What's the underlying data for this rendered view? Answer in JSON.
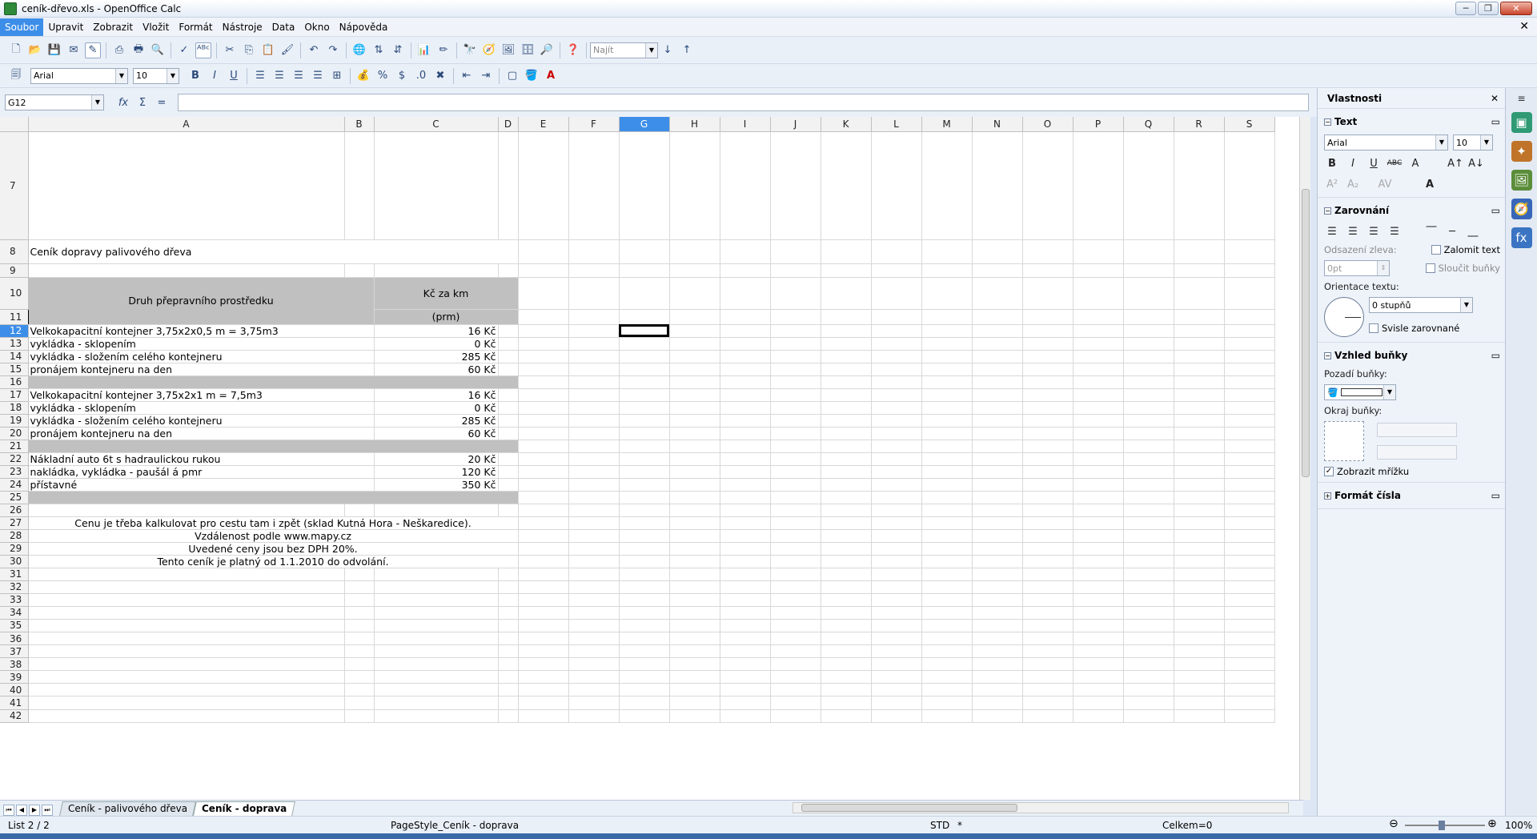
{
  "window": {
    "title": "ceník-dřevo.xls - OpenOffice Calc",
    "doc_close": "✕"
  },
  "menu": [
    "Soubor",
    "Upravit",
    "Zobrazit",
    "Vložit",
    "Formát",
    "Nástroje",
    "Data",
    "Okno",
    "Nápověda"
  ],
  "toolbar": {
    "find_placeholder": "Najít",
    "font_name": "Arial",
    "font_size": "10"
  },
  "formula_bar": {
    "cell_ref": "G12",
    "content": ""
  },
  "columns": [
    "A",
    "B",
    "C",
    "D",
    "E",
    "F",
    "G",
    "H",
    "I",
    "J",
    "K",
    "L",
    "M",
    "N",
    "O",
    "P",
    "Q",
    "R",
    "S"
  ],
  "selected_column": "G",
  "selected_row": "12",
  "sheet": {
    "title": "Ceník dopravy palivového dřeva",
    "header_vehicle": "Druh přepravního prostředku",
    "header_price_1": "Kč za km",
    "header_price_2": "(prm)",
    "rows": [
      {
        "row": "12",
        "label": "Velkokapacitní kontejner 3,75x2x0,5 m = 3,75m3",
        "price": "16 Kč",
        "bold": true
      },
      {
        "row": "13",
        "label": "vykládka - sklopením",
        "price": "0 Kč"
      },
      {
        "row": "14",
        "label": "vykládka - složením celého kontejneru",
        "price": "285 Kč"
      },
      {
        "row": "15",
        "label": "pronájem kontejneru na den",
        "price": "60 Kč"
      },
      {
        "row": "17",
        "label": "Velkokapacitní kontejner 3,75x2x1 m = 7,5m3",
        "price": "16 Kč",
        "bold": true
      },
      {
        "row": "18",
        "label": "vykládka - sklopením",
        "price": "0 Kč"
      },
      {
        "row": "19",
        "label": "vykládka - složením celého kontejneru",
        "price": "285 Kč"
      },
      {
        "row": "20",
        "label": "pronájem kontejneru na den",
        "price": "60 Kč"
      },
      {
        "row": "22",
        "label": "Nákladní auto 6t s hadraulickou rukou",
        "price": "20 Kč",
        "bold": true
      },
      {
        "row": "23",
        "label": "nakládka, vykládka - paušál á pmr",
        "price": "120 Kč"
      },
      {
        "row": "24",
        "label": "přístavné",
        "price": "350 Kč"
      }
    ],
    "notes": [
      "Cenu je třeba kalkulovat pro cestu tam i zpět (sklad Kutná Hora - Neškaredice).",
      "Vzdálenost podle www.mapy.cz",
      "Uvedené ceny jsou bez DPH 20%.",
      "Tento ceník je platný od 1.1.2010 do odvolání."
    ]
  },
  "tabs": [
    "Ceník - palivového dřeva",
    "Ceník - doprava"
  ],
  "active_tab": "Ceník - doprava",
  "status": {
    "sheet": "List 2 / 2",
    "page_style": "PageStyle_Ceník - doprava",
    "mode": "STD",
    "modified": "*",
    "sum": "Celkem=0",
    "zoom": "100%"
  },
  "sidebar": {
    "title": "Vlastnosti",
    "text_panel": {
      "title": "Text",
      "font": "Arial",
      "size": "10"
    },
    "align_panel": {
      "title": "Zarovnání",
      "indent_label": "Odsazení zleva:",
      "indent_value": "0pt",
      "wrap": "Zalomit text",
      "merge": "Sloučit buňky",
      "orient_label": "Orientace textu:",
      "orient_value": "0 stupňů",
      "vertical": "Svisle zarovnané"
    },
    "cell_panel": {
      "title": "Vzhled buňky",
      "bg_label": "Pozadí buňky:",
      "border_label": "Okraj buňky:",
      "grid": "Zobrazit mřížku"
    },
    "number_panel": {
      "title": "Formát čísla"
    }
  }
}
